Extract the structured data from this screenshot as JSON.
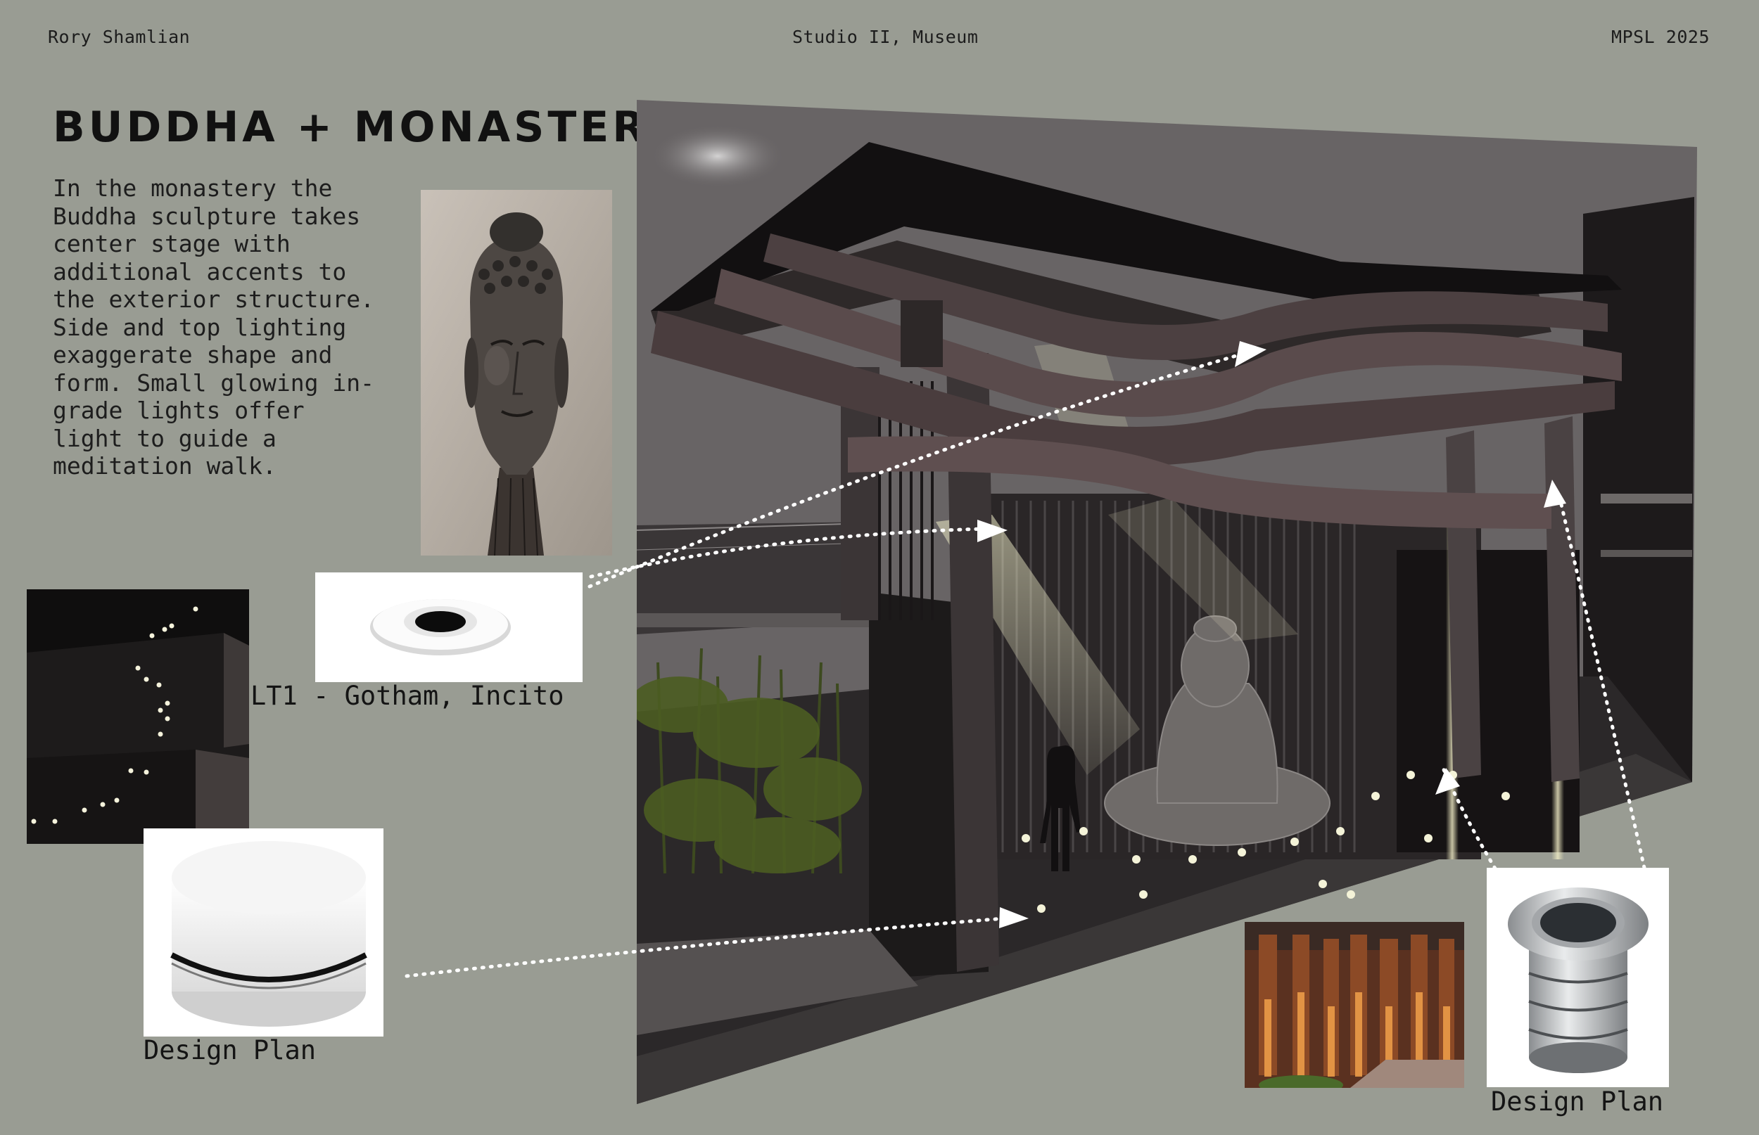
{
  "header": {
    "author": "Rory Shamlian",
    "course": "Studio II, Museum",
    "program": "MPSL 2025"
  },
  "title": "BUDDHA + MONASTERY",
  "description": "In the monastery the Buddha sculpture takes center stage with additional accents to the exterior structure. Side and top lighting exaggerate shape and form. Small glowing in-grade lights offer light to guide a meditation walk.",
  "fixtures": {
    "downlight_caption": "LT1 - Gotham, Incito",
    "puck_caption": "Design Plan",
    "inground_caption": "Design Plan"
  },
  "images": {
    "buddha_photo": "buddha-head-icon",
    "path_photo": "path-lights-icon",
    "downlight": "recessed-downlight-icon",
    "puck": "puck-light-icon",
    "uplight_photo": "uplight-columns-icon",
    "inground": "inground-uplight-icon",
    "render": "monastery-render"
  },
  "colors": {
    "background": "#999c93",
    "beam": "#e8e6c4",
    "dots": "#f4f3d8"
  }
}
